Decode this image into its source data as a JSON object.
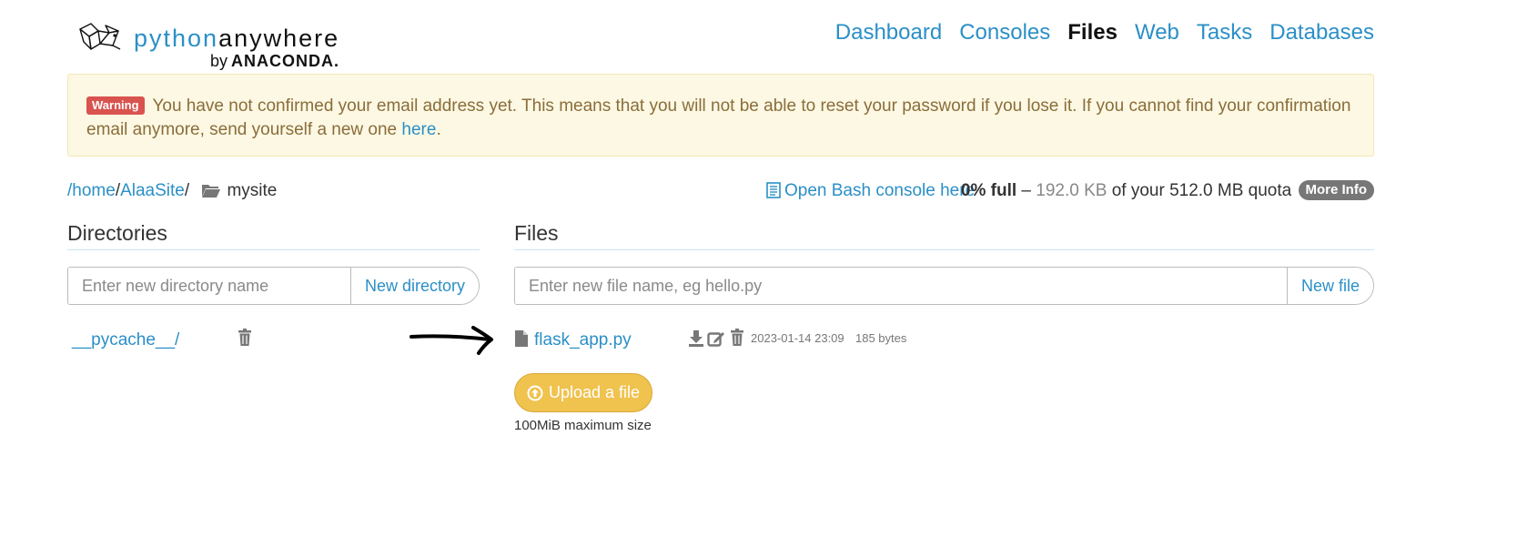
{
  "brand": {
    "python": "python",
    "anywhere": "anywhere",
    "by": "by",
    "anaconda": "ANACONDA."
  },
  "nav": [
    "Dashboard",
    "Consoles",
    "Files",
    "Web",
    "Tasks",
    "Databases"
  ],
  "nav_active": "Files",
  "warning": {
    "badge": "Warning",
    "text": "You have not confirmed your email address yet. This means that you will not be able to reset your password if you lose it. If you cannot find your confirmation email anymore, send yourself a new one",
    "link": "here",
    "end": "."
  },
  "breadcrumb": {
    "root": "/home",
    "sep1": "/",
    "user": "AlaaSite",
    "sep2": "/",
    "current": "mysite"
  },
  "bash_link": "Open Bash console here",
  "quota": {
    "percent": "0% full",
    "dash": " – ",
    "used": "192.0 KB",
    "of": " of your 512.0 MB quota",
    "more": "More Info"
  },
  "directories": {
    "title": "Directories",
    "placeholder": "Enter new directory name",
    "button": "New directory",
    "items": [
      {
        "name": "__pycache__/"
      }
    ]
  },
  "files": {
    "title": "Files",
    "placeholder": "Enter new file name, eg hello.py",
    "button": "New file",
    "items": [
      {
        "name": "flask_app.py",
        "modified": "2023-01-14 23:09",
        "size": "185 bytes"
      }
    ]
  },
  "upload": {
    "label": "Upload a file",
    "note": "100MiB maximum size"
  },
  "colors": {
    "link": "#2b8fc7",
    "warning_bg": "#fcf8e3",
    "warning_badge": "#d9534f",
    "upload": "#f0c24e"
  }
}
